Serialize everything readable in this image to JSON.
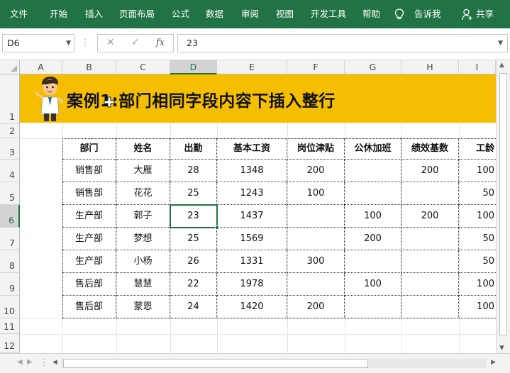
{
  "ribbon": {
    "tabs": [
      "文件",
      "开始",
      "插入",
      "页面布局",
      "公式",
      "数据",
      "审阅",
      "视图",
      "开发工具",
      "帮助"
    ],
    "tell_me": "告诉我",
    "share": "共享",
    "bg_color": "#217346"
  },
  "formula_bar": {
    "name_box": "D6",
    "formula_value": "23",
    "cancel_icon": "✕",
    "enter_icon": "✓",
    "fx_label": "fx"
  },
  "columns": [
    "A",
    "B",
    "C",
    "D",
    "E",
    "F",
    "G",
    "H",
    "I"
  ],
  "selected_column": "D",
  "rows": [
    "1",
    "2",
    "3",
    "4",
    "5",
    "6",
    "7",
    "8",
    "9",
    "10",
    "11",
    "12"
  ],
  "selected_row": "6",
  "banner": {
    "title": "案例1:部门相同字段内容下插入整行",
    "bg_color": "#f5bf00"
  },
  "table": {
    "headers": [
      "部门",
      "姓名",
      "出勤",
      "基本工资",
      "岗位津贴",
      "公休加班",
      "绩效基数",
      "工龄"
    ],
    "rows": [
      [
        "销售部",
        "大雁",
        "28",
        "1348",
        "200",
        "",
        "200",
        "100"
      ],
      [
        "销售部",
        "花花",
        "25",
        "1243",
        "100",
        "",
        "",
        "50"
      ],
      [
        "生产部",
        "郭子",
        "23",
        "1437",
        "",
        "100",
        "200",
        "100"
      ],
      [
        "生产部",
        "梦想",
        "25",
        "1569",
        "",
        "200",
        "",
        "50"
      ],
      [
        "生产部",
        "小杨",
        "26",
        "1331",
        "300",
        "",
        "",
        "50"
      ],
      [
        "售后部",
        "慧慧",
        "22",
        "1978",
        "",
        "100",
        "",
        "100"
      ],
      [
        "售后部",
        "蒙恩",
        "24",
        "1420",
        "200",
        "",
        "",
        "100"
      ]
    ]
  },
  "active_cell": "D6",
  "accent_color": "#217346"
}
